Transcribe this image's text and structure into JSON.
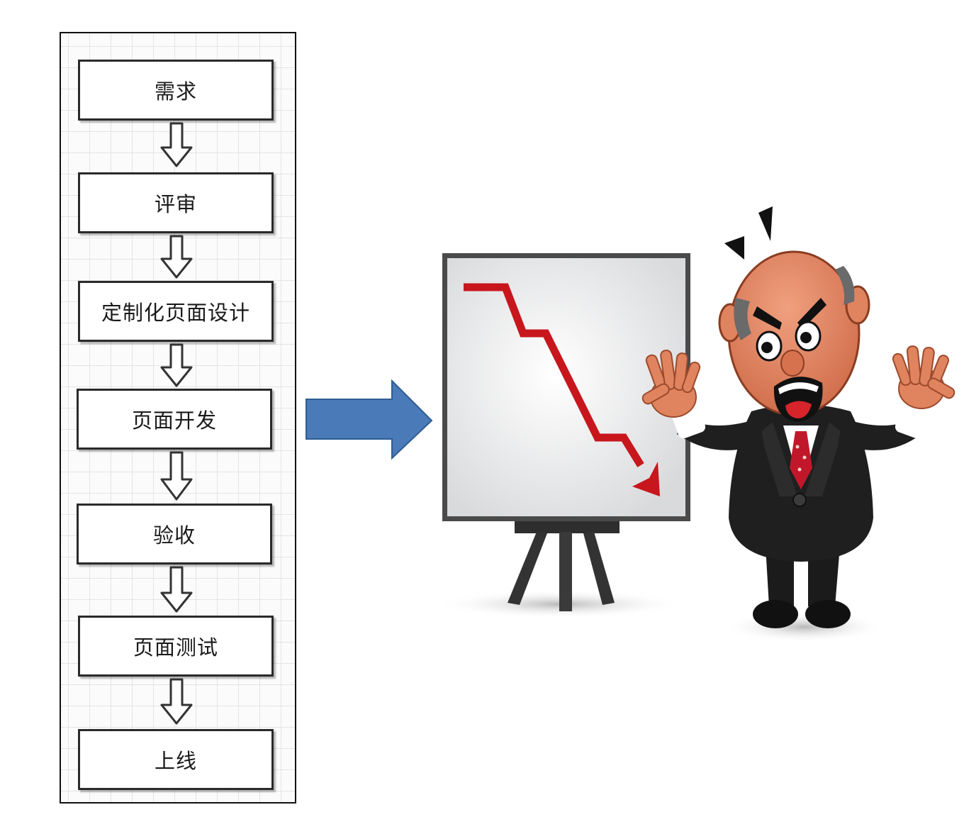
{
  "flow": {
    "steps": [
      {
        "label": "需求"
      },
      {
        "label": "评审"
      },
      {
        "label": "定制化页面设计"
      },
      {
        "label": "页面开发"
      },
      {
        "label": "验收"
      },
      {
        "label": "页面测试"
      },
      {
        "label": "上线"
      }
    ]
  },
  "icons": [
    "down-arrow-icon",
    "right-arrow-icon",
    "declining-chart-easel",
    "angry-boss-cartoon"
  ],
  "colors": {
    "arrow_blue": "#4a7ab7",
    "arrow_blue_border": "#2e5d92",
    "trend_red": "#c8161d",
    "easel_dark": "#3a3a3a",
    "suit_black": "#1b1b1b",
    "skin": "#e0845f"
  }
}
